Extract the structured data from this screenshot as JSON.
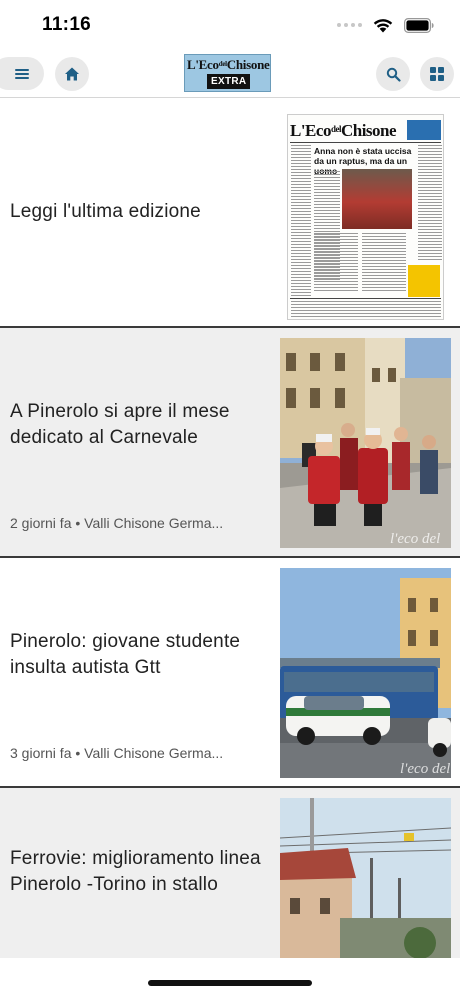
{
  "status_bar": {
    "time": "11:16",
    "icons": [
      "cellular-dots-icon",
      "wifi-icon",
      "battery-icon"
    ]
  },
  "app_bar": {
    "logo_text_top": "L'Eco del Chisone",
    "logo_text_bottom": "EXTRA",
    "icons": [
      "menu-icon",
      "home-icon",
      "search-icon",
      "grid-icon"
    ]
  },
  "feed": {
    "items": [
      {
        "title": "Leggi l'ultima edizione",
        "thumbnail": "newspaper-front-page",
        "newspaper": {
          "masthead": "L'Eco del Chisone",
          "headline": "Anna non è stata uccisa da un raptus, ma da un uomo"
        }
      },
      {
        "title": "A Pinerolo si apre il mese dedicato al Carnevale",
        "meta": "2 giorni fa • Valli Chisone Germa...",
        "thumbnail": "carnival-parade-photo",
        "watermark": "l'eco del"
      },
      {
        "title": "Pinerolo: giovane studente insulta autista Gtt",
        "meta": "3 giorni fa • Valli Chisone Germa...",
        "thumbnail": "bus-and-police-car-photo",
        "watermark": "l'eco del"
      },
      {
        "title": "Ferrovie: miglioramento linea Pinerolo -Torino in stallo",
        "meta": "",
        "thumbnail": "railway-line-photo"
      }
    ]
  },
  "colors": {
    "shaded_card": "#efefef",
    "divider": "#3a3a3a",
    "button_bg": "#e9e9e9",
    "icon_blue": "#1f5f86"
  }
}
